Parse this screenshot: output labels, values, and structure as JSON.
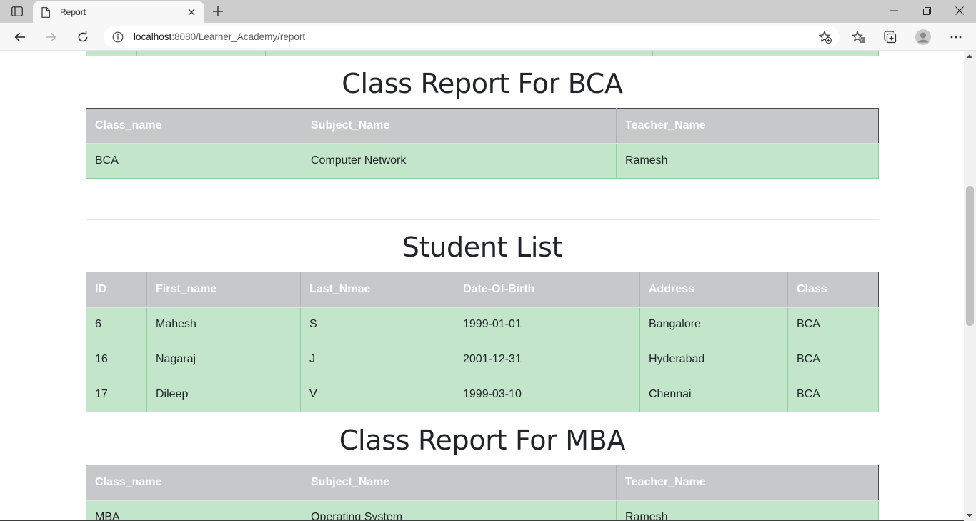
{
  "browser": {
    "tab_title": "Report",
    "url_host": "localhost",
    "url_path": ":8080/Learner_Academy/report"
  },
  "sections": {
    "bca_class": {
      "title": "Class Report For BCA",
      "headers": [
        "Class_name",
        "Subject_Name",
        "Teacher_Name"
      ],
      "rows": [
        [
          "BCA",
          "Computer Network",
          "Ramesh"
        ]
      ]
    },
    "student_list": {
      "title": "Student List",
      "headers": [
        "ID",
        "First_name",
        "Last_Nmae",
        "Date-Of-Birth",
        "Address",
        "Class"
      ],
      "rows": [
        [
          "6",
          "Mahesh",
          "S",
          "1999-01-01",
          "Bangalore",
          "BCA"
        ],
        [
          "16",
          "Nagaraj",
          "J",
          "2001-12-31",
          "Hyderabad",
          "BCA"
        ],
        [
          "17",
          "Dileep",
          "V",
          "1999-03-10",
          "Chennai",
          "BCA"
        ]
      ]
    },
    "mba_class": {
      "title": "Class Report For MBA",
      "headers": [
        "Class_name",
        "Subject_Name",
        "Teacher_Name"
      ],
      "rows": [
        [
          "MBA",
          "Operating System",
          "Ramesh"
        ]
      ]
    }
  }
}
